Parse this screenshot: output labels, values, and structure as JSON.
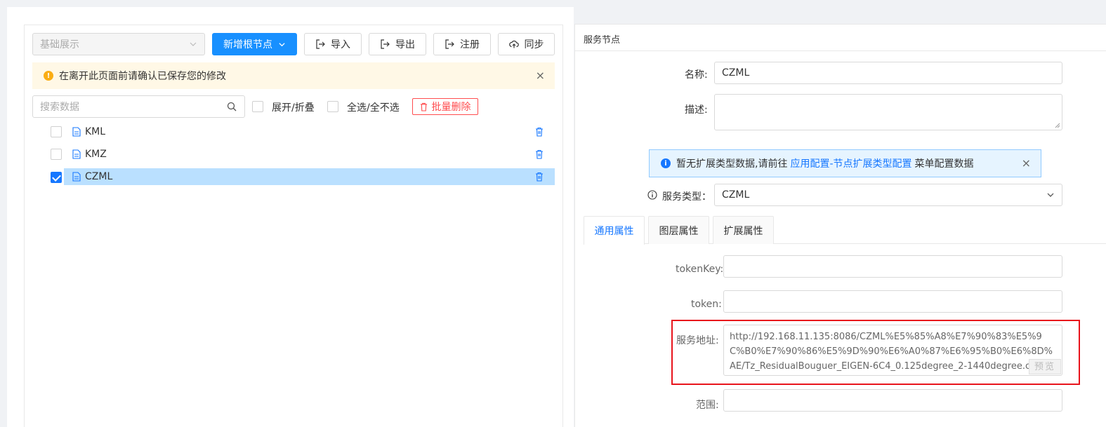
{
  "toolbar": {
    "view_select": "基础展示",
    "add_root_button": "新增根节点",
    "import_button": "导入",
    "export_button": "导出",
    "register_button": "注册",
    "sync_button": "同步"
  },
  "warning_alert": {
    "text": "在离开此页面前请确认已保存您的修改",
    "close": "×"
  },
  "tree_controls": {
    "search_placeholder": "搜索数据",
    "expand_collapse_label": "展开/折叠",
    "select_all_label": "全选/全不选",
    "batch_delete_button": "批量删除"
  },
  "tree_nodes": [
    {
      "label": "KML",
      "checked": false,
      "selected": false
    },
    {
      "label": "KMZ",
      "checked": false,
      "selected": false
    },
    {
      "label": "CZML",
      "checked": true,
      "selected": true
    }
  ],
  "detail": {
    "title": "服务节点",
    "name_label": "名称:",
    "name_value": "CZML",
    "desc_label": "描述:",
    "desc_value": "",
    "info_alert": {
      "prefix": "暂无扩展类型数据,请前往",
      "link": "应用配置-节点扩展类型配置",
      "suffix": "菜单配置数据",
      "close": "×"
    },
    "service_type_label": "服务类型：",
    "service_type_value": "CZML",
    "tabs": [
      "通用属性",
      "图层属性",
      "扩展属性"
    ],
    "token_key_label": "tokenKey:",
    "token_label": "token:",
    "service_url_label": "服务地址:",
    "service_url_value": "http://192.168.11.135:8086/CZML%E5%85%A8%E7%90%83%E5%9C%B0%E7%90%86%E5%9D%90%E6%A0%87%E6%95%B0%E6%8D%AE/Tz_ResidualBouguer_EIGEN-6C4_0.125degree_2-1440degree.czml",
    "preview_button": "预览",
    "range_label": "范围:"
  },
  "colors": {
    "primary": "#1890ff",
    "link": "#1677ff",
    "warning": "#faad14",
    "danger": "#ff4d4f",
    "highlight": "#e8141c",
    "selected_row": "#bae0ff"
  }
}
